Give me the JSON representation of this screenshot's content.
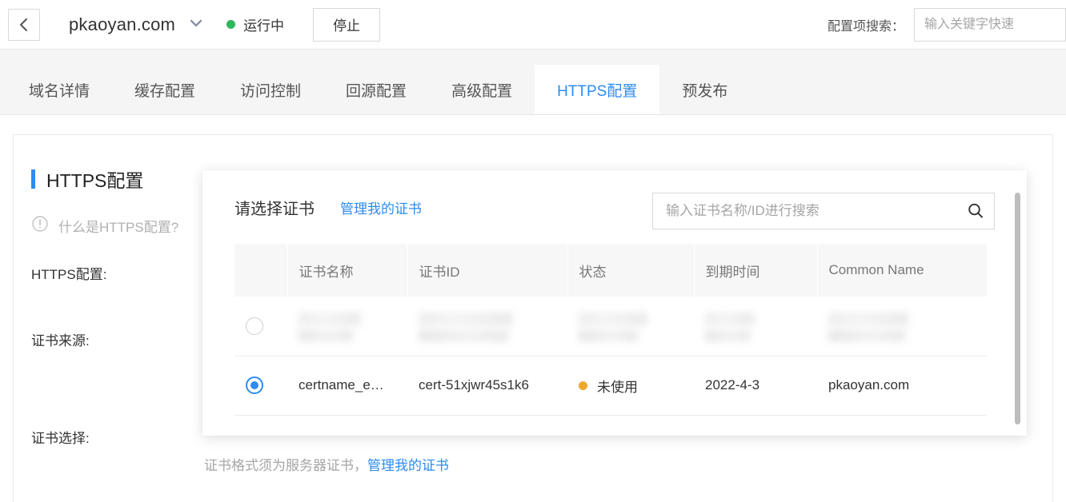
{
  "header": {
    "back_icon": "chevron-left-icon",
    "domain": "pkaoyan.com",
    "dropdown_icon": "chevron-down-icon",
    "status_text": "运行中",
    "status_color": "#2eb85c",
    "stop_label": "停止",
    "config_search_label": "配置项搜索：",
    "config_search_placeholder": "输入关键字快速"
  },
  "tabs": [
    {
      "label": "域名详情",
      "active": false
    },
    {
      "label": "缓存配置",
      "active": false
    },
    {
      "label": "访问控制",
      "active": false
    },
    {
      "label": "回源配置",
      "active": false
    },
    {
      "label": "高级配置",
      "active": false
    },
    {
      "label": "HTTPS配置",
      "active": true
    },
    {
      "label": "预发布",
      "active": false
    }
  ],
  "main": {
    "section_title": "HTTPS配置",
    "help_icon": "info-circle-icon",
    "help_text": "什么是HTTPS配置?",
    "label_https": "HTTPS配置:",
    "label_source": "证书来源:",
    "label_select": "证书选择:",
    "hint_text": "证书格式须为服务器证书，",
    "hint_link": "管理我的证书"
  },
  "cert_panel": {
    "title": "请选择证书",
    "manage_link": "管理我的证书",
    "search_placeholder": "输入证书名称/ID进行搜索",
    "search_icon": "search-icon",
    "columns": [
      "",
      "证书名称",
      "证书ID",
      "状态",
      "到期时间",
      "Common Name"
    ],
    "rows": [
      {
        "selected": false,
        "redacted": true,
        "name": "",
        "id": "",
        "status": "",
        "status_color": "#9e9e9e",
        "expiry": "",
        "common_name": ""
      },
      {
        "selected": true,
        "redacted": false,
        "name": "certname_e…",
        "id": "cert-51xjwr45s1k6",
        "status": "未使用",
        "status_color": "#f0a72f",
        "expiry": "2022-4-3",
        "common_name": "pkaoyan.com"
      }
    ]
  },
  "colors": {
    "accent": "#2d8cf0",
    "running": "#2eb85c",
    "warning": "#f0a72f"
  }
}
